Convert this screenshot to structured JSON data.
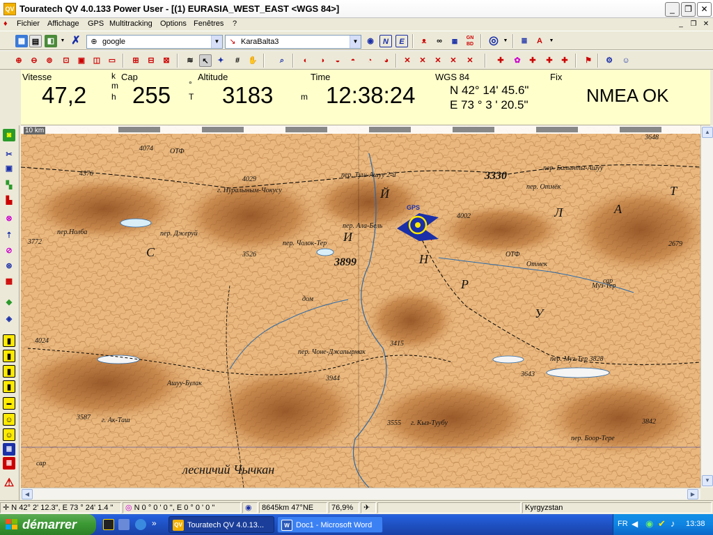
{
  "window": {
    "title": "Touratech QV 4.0.133 Power User - [(1) EURASIA_WEST_EAST <WGS 84>]",
    "app_icon": "QV"
  },
  "menu": [
    "Fichier",
    "Affichage",
    "GPS",
    "Multitracking",
    "Options",
    "Fenêtres",
    "?"
  ],
  "toolbar": {
    "map_source": "google",
    "track": "KaraBalta3"
  },
  "gps_panel": {
    "speed_label": "Vitesse",
    "speed_value": "47,2",
    "speed_unit_top": "k",
    "speed_unit_mid": "m",
    "speed_unit_bot": "h",
    "cap_label": "Cap",
    "cap_value": "255",
    "cap_unit_top": "°",
    "cap_unit_bot": "T",
    "altitude_label": "Altitude",
    "altitude_value": "3183",
    "altitude_unit": "m",
    "time_label": "Time",
    "time_value": "12:38:24",
    "datum_label": "WGS 84",
    "lat": "N 42°  14' 45.6\"",
    "lon": "E 73 °  3 ' 20.5\"",
    "fix_label": "Fix",
    "fix_value": "NMEA OK"
  },
  "map": {
    "scale_label": "10 km",
    "gps_marker_label": "GPS",
    "labels": [
      {
        "text": "4074"
      },
      {
        "text": "ОТФ"
      },
      {
        "text": "4376"
      },
      {
        "text": "4029"
      },
      {
        "text": "г. Нуралыным-Чокусу"
      },
      {
        "text": "пер. Туш-Ашуу 2-й"
      },
      {
        "text": "3330"
      },
      {
        "text": "пер. Балынты-Ашуу"
      },
      {
        "text": "пер. Отмёк"
      },
      {
        "text": "3648"
      },
      {
        "text": "пер.Нолба"
      },
      {
        "text": "3772"
      },
      {
        "text": "пер. Джеруй"
      },
      {
        "text": "пер. Ала-Бель"
      },
      {
        "text": "4002"
      },
      {
        "text": "2679"
      },
      {
        "text": "пер. Чолок-Тер"
      },
      {
        "text": "3899"
      },
      {
        "text": "3526"
      },
      {
        "text": "ОТФ"
      },
      {
        "text": "Отмек"
      },
      {
        "text": "сар"
      },
      {
        "text": "дом"
      },
      {
        "text": "Муз-Тер"
      },
      {
        "text": "4024"
      },
      {
        "text": "пер. Чоне-Джапырмак"
      },
      {
        "text": "3415"
      },
      {
        "text": "3944"
      },
      {
        "text": "пер. Муз-Тер 3828"
      },
      {
        "text": "3643"
      },
      {
        "text": "Ашуу-Булак"
      },
      {
        "text": "3587"
      },
      {
        "text": "г. Ак-Таш"
      },
      {
        "text": "3555"
      },
      {
        "text": "г. Кыз-Туубу"
      },
      {
        "text": "пер. Боор-Тере"
      },
      {
        "text": "3842"
      },
      {
        "text": "сар"
      },
      {
        "text": "лесничий Чычкан"
      },
      {
        "text": "Т"
      },
      {
        "text": "А"
      },
      {
        "text": "Л"
      },
      {
        "text": "Р"
      },
      {
        "text": "С"
      },
      {
        "text": "У"
      },
      {
        "text": "Н"
      },
      {
        "text": "И"
      },
      {
        "text": "Й"
      }
    ]
  },
  "status": {
    "cursor_pos": "N 42° 2' 12.3\", E 73 ° 24' 1.4 \"",
    "offset": "N 0 ° 0 ' 0   \", E 0 ° 0 ' 0   \"",
    "distance": "8645km 47°NE",
    "zoom": "76,9%",
    "region": "Kyrgyzstan"
  },
  "taskbar": {
    "start_label": "démarrer",
    "tasks": [
      {
        "label": "Touratech QV 4.0.13...",
        "icon": "QV"
      },
      {
        "label": "Doc1 - Microsoft Word",
        "icon": "W"
      }
    ],
    "more": "»",
    "lang": "FR",
    "clock": "13:38"
  }
}
